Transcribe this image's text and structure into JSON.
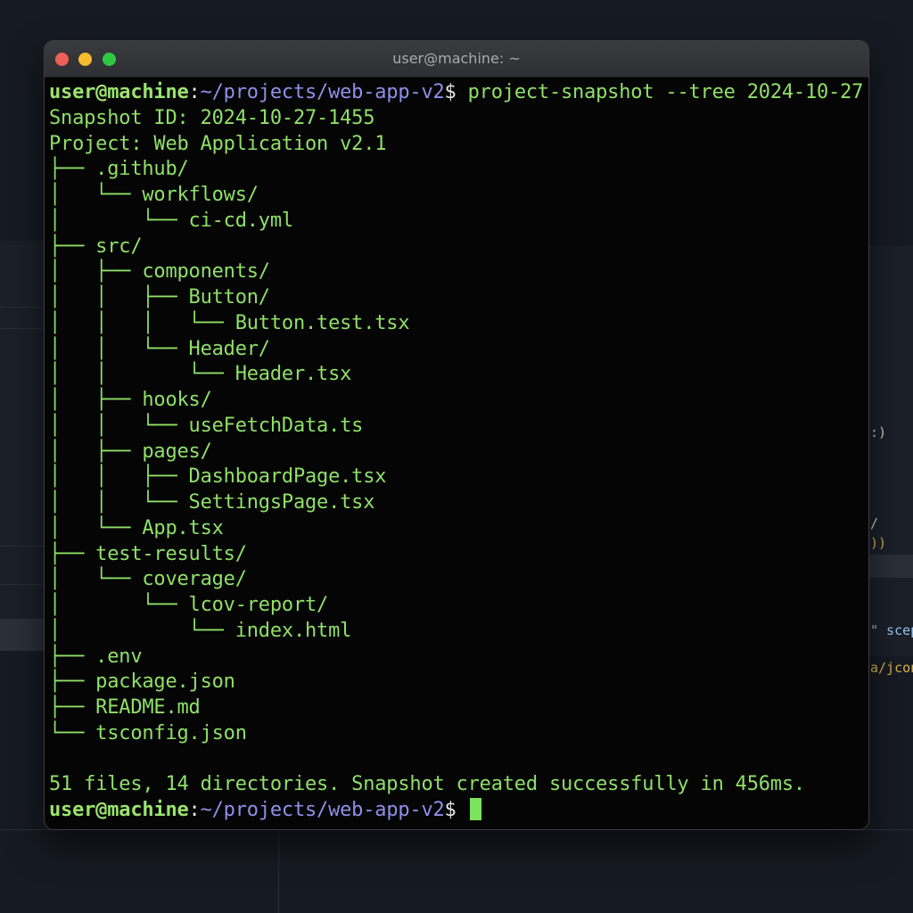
{
  "window": {
    "title": "user@machine: ~"
  },
  "prompt": {
    "user_host": "user@machine",
    "colon": ":",
    "path": "~/projects/web-app-v2",
    "dollar": "$"
  },
  "command": "project-snapshot --tree 2024-10-27",
  "output": {
    "snapshot_id": "Snapshot ID: 2024-10-27-1455",
    "project": "Project: Web Application v2.1",
    "tree": [
      "├── .github/",
      "│   └── workflows/",
      "│       └── ci-cd.yml",
      "├── src/",
      "│   ├── components/",
      "│   │   ├── Button/",
      "│   │   │   └── Button.test.tsx",
      "│   │   └── Header/",
      "│   │       └── Header.tsx",
      "│   ├── hooks/",
      "│   │   └── useFetchData.ts",
      "│   ├── pages/",
      "│   │   ├── DashboardPage.tsx",
      "│   │   └── SettingsPage.tsx",
      "│   └── App.tsx",
      "├── test-results/",
      "│   └── coverage/",
      "│       └── lcov-report/",
      "│           └── index.html",
      "├── .env",
      "├── package.json",
      "├── README.md",
      "└── tsconfig.json"
    ],
    "blank": "",
    "summary": "51 files, 14 directories. Snapshot created successfully in 456ms."
  },
  "background": {
    "fragments": [
      ":)",
      "/",
      "))",
      "\" scep",
      "a/jcon"
    ]
  },
  "colors": {
    "terminal_bg": "#050505",
    "text_green": "#8fe068",
    "prompt_user": "#9be36f",
    "prompt_path": "#8f8fe9",
    "cursor": "#7ce35f"
  }
}
